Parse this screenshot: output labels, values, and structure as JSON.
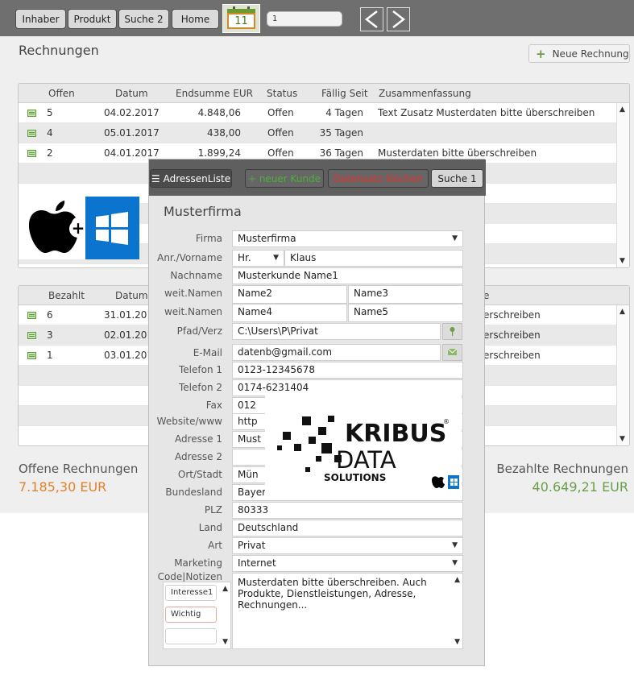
{
  "toolbar": {
    "buttons": [
      "Inhaber",
      "Produkt",
      "Suche 2",
      "Home"
    ],
    "calendar_day": "11",
    "field_value": "1"
  },
  "page": {
    "title": "Rechnungen",
    "new_invoice_label": "Neue Rechnung"
  },
  "open_table": {
    "headers": [
      "Offen",
      "Datum",
      "Endsumme  EUR",
      "Status",
      "Fällig Seit",
      "Zusammenfassung"
    ],
    "rows": [
      {
        "nr": "5",
        "datum": "04.02.2017",
        "summe": "4.848,06",
        "status": "Offen",
        "faellig": "4 Tagen",
        "summary": "Text Zusatz Musterdaten bitte überschreiben"
      },
      {
        "nr": "4",
        "datum": "05.01.2017",
        "summe": "438,00",
        "status": "Offen",
        "faellig": "35 Tagen",
        "summary": ""
      },
      {
        "nr": "2",
        "datum": "04.01.2017",
        "summe": "1.899,24",
        "status": "Offen",
        "faellig": "36 Tagen",
        "summary": "Musterdaten bitte überschreiben"
      }
    ]
  },
  "paid_table": {
    "headers": [
      "Bezahlt",
      "Datum",
      "e"
    ],
    "rows": [
      {
        "nr": "6",
        "datum": "31.01.201",
        "summary": "erschreiben"
      },
      {
        "nr": "3",
        "datum": "02.01.201",
        "summary": "erschreiben"
      },
      {
        "nr": "1",
        "datum": "03.01.201",
        "summary": "erschreiben"
      }
    ]
  },
  "totals": {
    "open_label": "Offene Rechnungen",
    "open_value": "7.185,30 EUR",
    "paid_label": "Bezahlte Rechnungen",
    "paid_value": "40.649,21 EUR"
  },
  "dialog": {
    "buttons": [
      "AdressenListe",
      "+ neuer Kunde",
      "Datensatz löschen",
      "Suche 1"
    ],
    "title": "Musterfirma",
    "labels": [
      "Firma",
      "Anr./Vorname",
      "Nachname",
      "weit.Namen",
      "weit.Namen",
      "Pfad/Verz",
      "E-Mail",
      "Telefon 1",
      "Telefon 2",
      "Fax",
      "Website/www",
      "Adresse 1",
      "Adresse 2",
      "Ort/Stadt",
      "Bundesland",
      "PLZ",
      "Land",
      "Art",
      "Marketing",
      "Code|Notizen"
    ],
    "firma": "Musterfirma",
    "anrede": "Hr.",
    "vorname": "Klaus",
    "nachname": "Musterkunde Name1",
    "name2": "Name2",
    "name3": "Name3",
    "name4": "Name4",
    "name5": "Name5",
    "pfad": "C:\\Users\\P\\Privat",
    "email": "datenb@gmail.com",
    "telefon1": "0123-12345678",
    "telefon2": "0174-6231404",
    "fax": "012",
    "website": "http",
    "adresse1": "Must",
    "adresse2": "",
    "ort": "Mün",
    "bundesland": "Bayer",
    "plz": "80333",
    "land": "Deutschland",
    "art": "Privat",
    "marketing": "Internet",
    "codes": [
      "Interesse1",
      "Wichtig",
      ""
    ],
    "notizen": "Musterdaten bitte überschreiben. Auch Produkte, Dienstleistungen, Adresse, Rechnungen..."
  },
  "logo": {
    "line1": "KRIBUS",
    "line2": "DATA",
    "line3": "SOLUTIONS",
    "mark": "®"
  },
  "colors": {
    "open_total": "#e0832a",
    "paid_total": "#6aa04a",
    "new_customer": "#4fae3c",
    "delete_record": "#e0332f"
  }
}
